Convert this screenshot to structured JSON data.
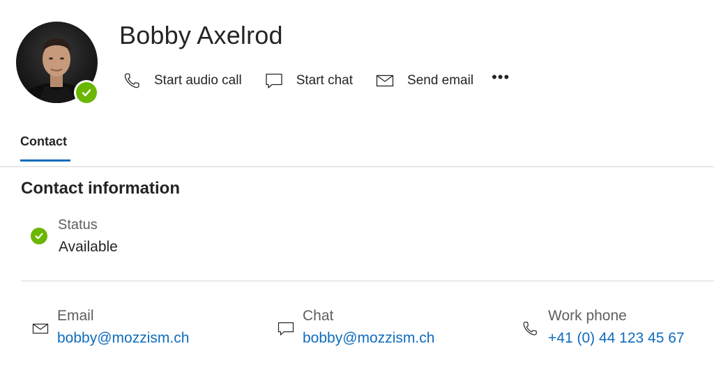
{
  "profile": {
    "name": "Bobby Axelrod",
    "avatar_icon": "person-photo",
    "presence_icon": "presence-available-icon",
    "presence_color": "#6bb700"
  },
  "actions": {
    "audio_call": "Start audio call",
    "chat": "Start chat",
    "email": "Send email",
    "more": "•••"
  },
  "tabs": [
    {
      "label": "Contact",
      "active": true
    }
  ],
  "accent_color": "#0f6cbd",
  "contact_info": {
    "title": "Contact information",
    "status": {
      "label": "Status",
      "value": "Available"
    },
    "email": {
      "label": "Email",
      "value": "bobby@mozzism.ch"
    },
    "chat": {
      "label": "Chat",
      "value": "bobby@mozzism.ch"
    },
    "work_phone": {
      "label": "Work phone",
      "value": "+41 (0) 44 123 45 67"
    }
  }
}
